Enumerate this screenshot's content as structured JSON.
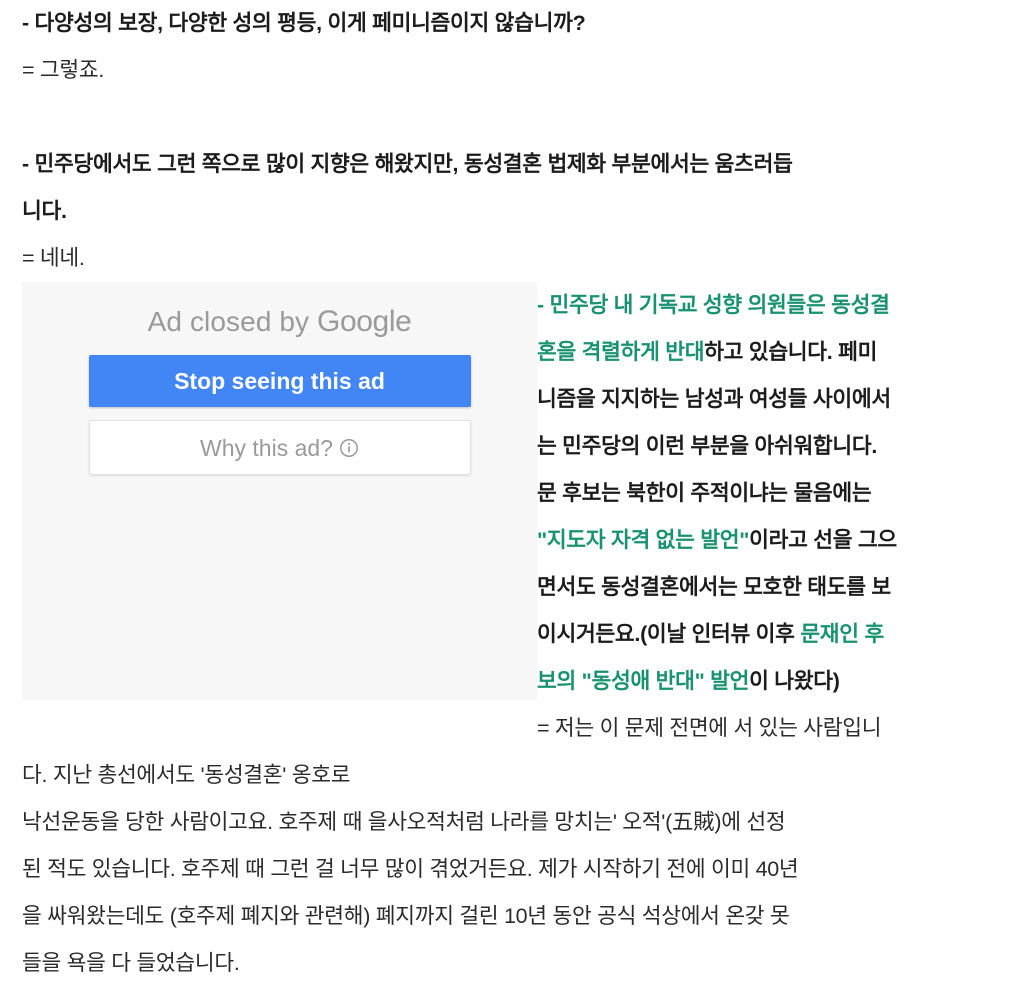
{
  "colors": {
    "highlight_teal": "#199272",
    "google_blue": "#4285f4",
    "ad_panel_bg": "#f7f7f7",
    "body_text": "#1c1c1c",
    "muted_gray": "#9a9a9a"
  },
  "interview": {
    "q1": "- 다양성의 보장, 다양한 성의 평등, 이게 페미니즘이지 않습니까?",
    "a1": "= 그렇죠.",
    "q2": "- 민주당에서도 그런 쪽으로 많이 지향은 해왔지만, 동성결혼 법제화 부분에서는 움츠러듭",
    "q2_cont": "니다.",
    "a2": "= 네네."
  },
  "ad_panel": {
    "heading_prefix": "Ad closed by ",
    "heading_brand": "Google",
    "stop_button_label": "Stop seeing this ad",
    "why_button_label": "Why this ad?",
    "info_icon_name": "info-icon"
  },
  "wrapped_block": {
    "q3_seg1_teal": "- 민주당 내 기독교 성향 의원들은 동성결",
    "q3_seg2_teal": "혼을 격렬하게 반대",
    "q3_seg3_black": "하고 있습니다. 페미",
    "q3_line3": "니즘을 지지하는 남성과 여성들 사이에서",
    "q3_line4": "는 민주당의 이런 부분을 아쉬워합니다.",
    "q3_line5": "문 후보는 북한이 주적이냐는 물음에는",
    "q3_line6_teal": "\"지도자 자격 없는 발언\"",
    "q3_line6_black": "이라고 선을 그으",
    "q3_line7": "면서도 동성결혼에서는 모호한 태도를 보",
    "q3_line8_black": "이시거든요.(이날 인터뷰 이후 ",
    "q3_line8_teal": "문재인 후",
    "q3_line9_teal": "보의 \"동성애 반대\" 발언",
    "q3_line9_black": "이 나왔다)",
    "a3_line1": "= 저는 이 문제 전면에 서 있는 사람입니",
    "a3_line2": "다. 지난 총선에서도 '동성결혼' 옹호로"
  },
  "tail_paragraph": {
    "line1": "낙선운동을 당한 사람이고요. 호주제 때 을사오적처럼 나라를 망치는' 오적'(五賊)에 선정",
    "line2": "된 적도 있습니다. 호주제 때 그런 걸 너무 많이 겪었거든요. 제가 시작하기 전에 이미 40년",
    "line3": "을 싸워왔는데도 (호주제 폐지와 관련해) 폐지까지 걸린 10년 동안 공식 석상에서 온갖 못",
    "line4": "들을 욕을 다 들었습니다."
  }
}
